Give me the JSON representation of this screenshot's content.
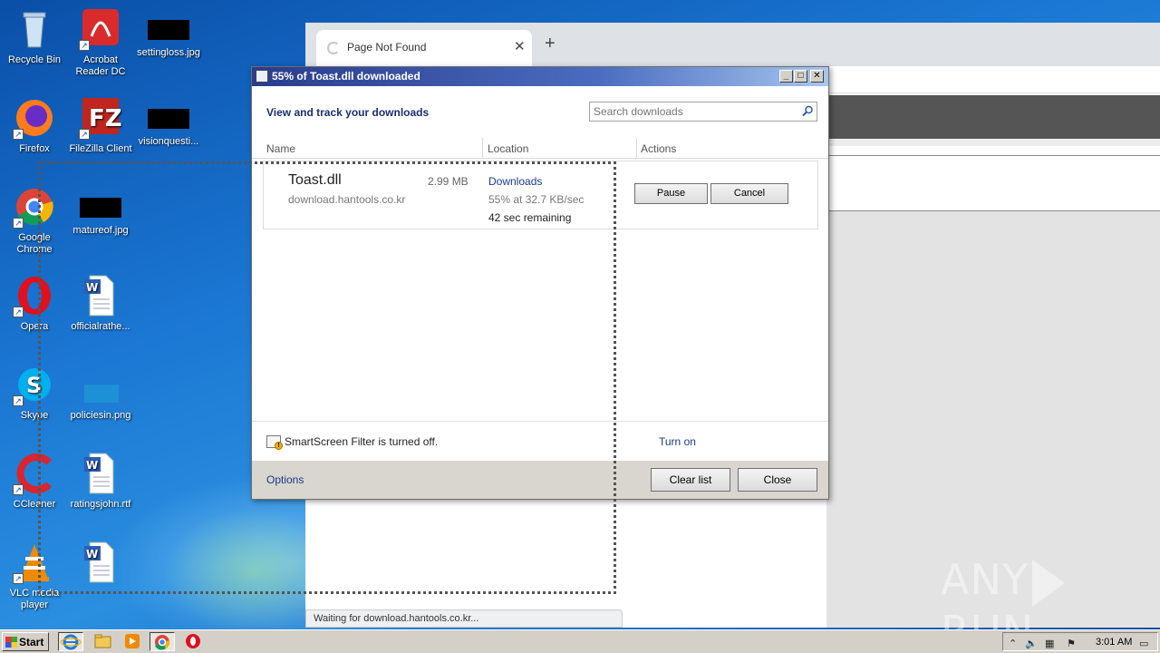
{
  "desktop": {
    "icons": [
      {
        "label": "Recycle Bin",
        "icon": "recycle-bin-icon"
      },
      {
        "label": "Acrobat Reader DC",
        "icon": "acrobat-icon"
      },
      {
        "label": "settingloss.jpg",
        "icon": "image-file-icon"
      },
      {
        "label": "Firefox",
        "icon": "firefox-icon"
      },
      {
        "label": "FileZilla Client",
        "icon": "filezilla-icon"
      },
      {
        "label": "visionquesti...",
        "icon": "image-file-icon"
      },
      {
        "label": "Google Chrome",
        "icon": "chrome-icon"
      },
      {
        "label": "matureof.jpg",
        "icon": "image-file-icon"
      },
      {
        "label": "Opera",
        "icon": "opera-icon"
      },
      {
        "label": "officialrathe...",
        "icon": "word-doc-icon"
      },
      {
        "label": "Skype",
        "icon": "skype-icon"
      },
      {
        "label": "policiesin.png",
        "icon": "image-file-icon"
      },
      {
        "label": "CCleaner",
        "icon": "ccleaner-icon"
      },
      {
        "label": "ratingsjohn.rtf",
        "icon": "word-doc-icon"
      },
      {
        "label": "VLC media player",
        "icon": "vlc-icon"
      },
      {
        "label": "",
        "icon": "word-doc-icon"
      }
    ]
  },
  "browser": {
    "tab_title": "Page Not Found",
    "status_text": "Waiting for download.hantools.co.kr..."
  },
  "dialog": {
    "title": "55% of Toast.dll downloaded",
    "heading": "View and track your downloads",
    "search_placeholder": "Search downloads",
    "columns": {
      "name": "Name",
      "location": "Location",
      "actions": "Actions"
    },
    "download": {
      "file_name": "Toast.dll",
      "size": "2.99 MB",
      "host": "download.hantools.co.kr",
      "location": "Downloads",
      "progress_text": "55% at 32.7 KB/sec",
      "progress_percent": 55,
      "remaining": "42 sec remaining",
      "pause_label": "Pause",
      "cancel_label": "Cancel"
    },
    "smartscreen_text": "SmartScreen Filter is turned off.",
    "turn_on_label": "Turn on",
    "options_label": "Options",
    "clear_list_label": "Clear list",
    "close_label": "Close"
  },
  "watermark": {
    "left": "ANY",
    "right": "RUN"
  },
  "taskbar": {
    "start_label": "Start",
    "clock": "3:01 AM",
    "pinned": [
      "internet-explorer-icon",
      "folder-icon",
      "media-player-icon",
      "chrome-icon",
      "opera-icon"
    ]
  }
}
